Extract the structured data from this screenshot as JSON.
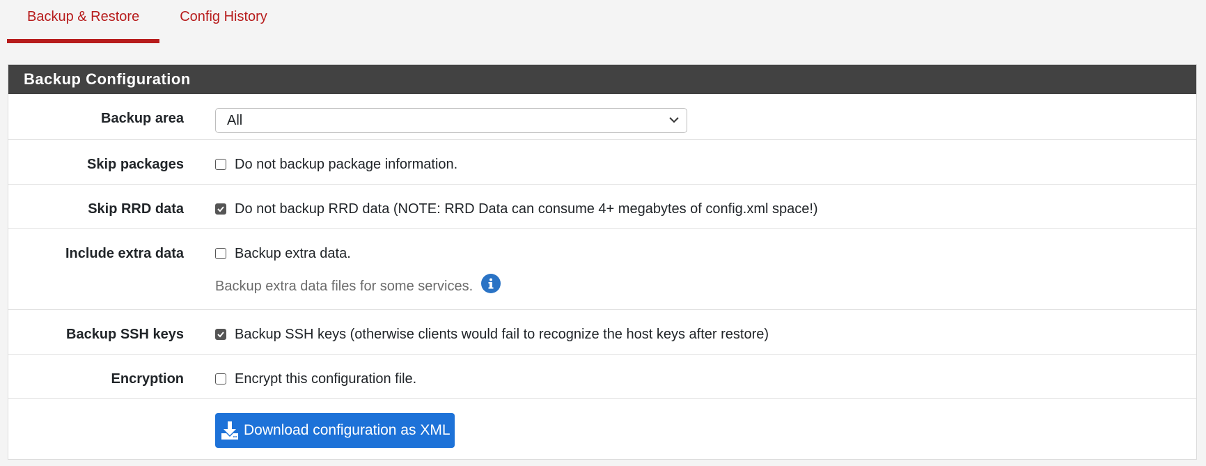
{
  "tabs": [
    {
      "label": "Backup & Restore",
      "active": true
    },
    {
      "label": "Config History",
      "active": false
    }
  ],
  "panel": {
    "title": "Backup Configuration"
  },
  "form": {
    "backup_area": {
      "label": "Backup area",
      "selected": "All"
    },
    "skip_packages": {
      "label": "Skip packages",
      "text": "Do not backup package information.",
      "checked": false
    },
    "skip_rrd": {
      "label": "Skip RRD data",
      "text": "Do not backup RRD data (NOTE: RRD Data can consume 4+ megabytes of config.xml space!)",
      "checked": true
    },
    "extra_data": {
      "label": "Include extra data",
      "text": "Backup extra data.",
      "help": "Backup extra data files for some services.",
      "checked": false
    },
    "ssh_keys": {
      "label": "Backup SSH keys",
      "text": "Backup SSH keys (otherwise clients would fail to recognize the host keys after restore)",
      "checked": true
    },
    "encryption": {
      "label": "Encryption",
      "text": "Encrypt this configuration file.",
      "checked": false
    },
    "download_button": "Download configuration as XML"
  },
  "colors": {
    "accent": "#b71c1c",
    "heading_bg": "#424242",
    "button_bg": "#1d72d8",
    "info_icon": "#2a73c5"
  }
}
